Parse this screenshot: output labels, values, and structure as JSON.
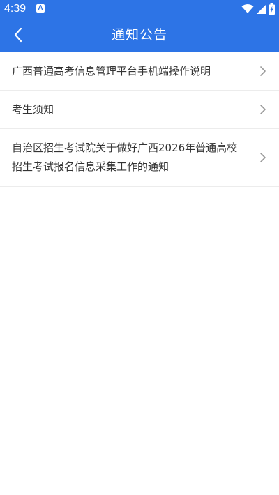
{
  "status_bar": {
    "time": "4:39",
    "notification_badge": "A",
    "icons": [
      "wifi-icon",
      "cell-signal-icon",
      "battery-charging-icon"
    ]
  },
  "app_bar": {
    "title": "通知公告",
    "back_icon": "chevron-left-icon"
  },
  "notices": [
    {
      "title": "广西普通高考信息管理平台手机端操作说明"
    },
    {
      "title": "考生须知"
    },
    {
      "title": "自治区招生考试院关于做好广西2026年普通高校招生考试报名信息采集工作的通知"
    }
  ],
  "colors": {
    "primary": "#2d74e6",
    "text": "#333333",
    "divider": "#ececec",
    "chevron": "#9a9a9a"
  }
}
